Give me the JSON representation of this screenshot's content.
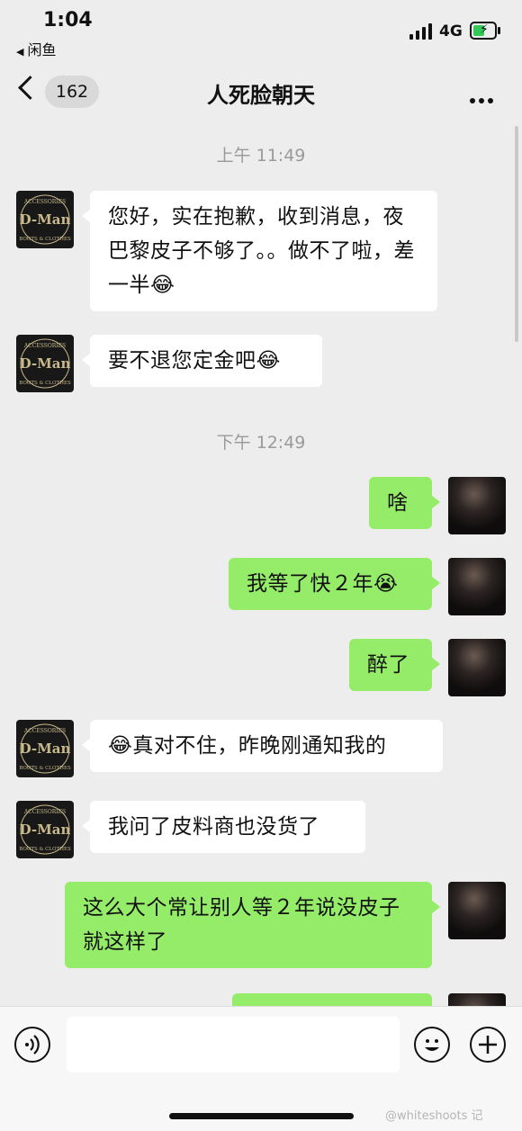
{
  "status": {
    "time": "1:04",
    "back_app": "闲鱼",
    "network": "4G"
  },
  "nav": {
    "unread": "162",
    "title": "人死脸朝天"
  },
  "timestamps": [
    "上午 11:49",
    "下午 12:49"
  ],
  "messages": [
    {
      "side": "left",
      "text": "您好，实在抱歉，收到消息，夜巴黎皮子不够了。。做不了啦，差一半😂"
    },
    {
      "side": "left",
      "text": "要不退您定金吧😂"
    },
    {
      "side": "right",
      "text": "啥"
    },
    {
      "side": "right",
      "text": "我等了快２年😭"
    },
    {
      "side": "right",
      "text": "醉了"
    },
    {
      "side": "left",
      "text": "😂真对不住，昨晚刚通知我的"
    },
    {
      "side": "left",
      "text": "我问了皮料商也没货了"
    },
    {
      "side": "right",
      "text": "这么大个常让别人等２年说没皮子就这样了"
    }
  ],
  "avatar_logo": {
    "brand": "D-Man",
    "top": "ACCESSORIES",
    "bottom": "BOOTS & CLOTHES",
    "color": "#c8b98a"
  },
  "composer": {
    "voice_icon": "voice-icon",
    "emoji_icon": "emoji-icon",
    "plus_icon": "plus-icon"
  },
  "watermark": "@whiteshoots 记",
  "colors": {
    "bg": "#ededed",
    "bubble_right": "#95ec69",
    "bubble_left": "#ffffff"
  }
}
